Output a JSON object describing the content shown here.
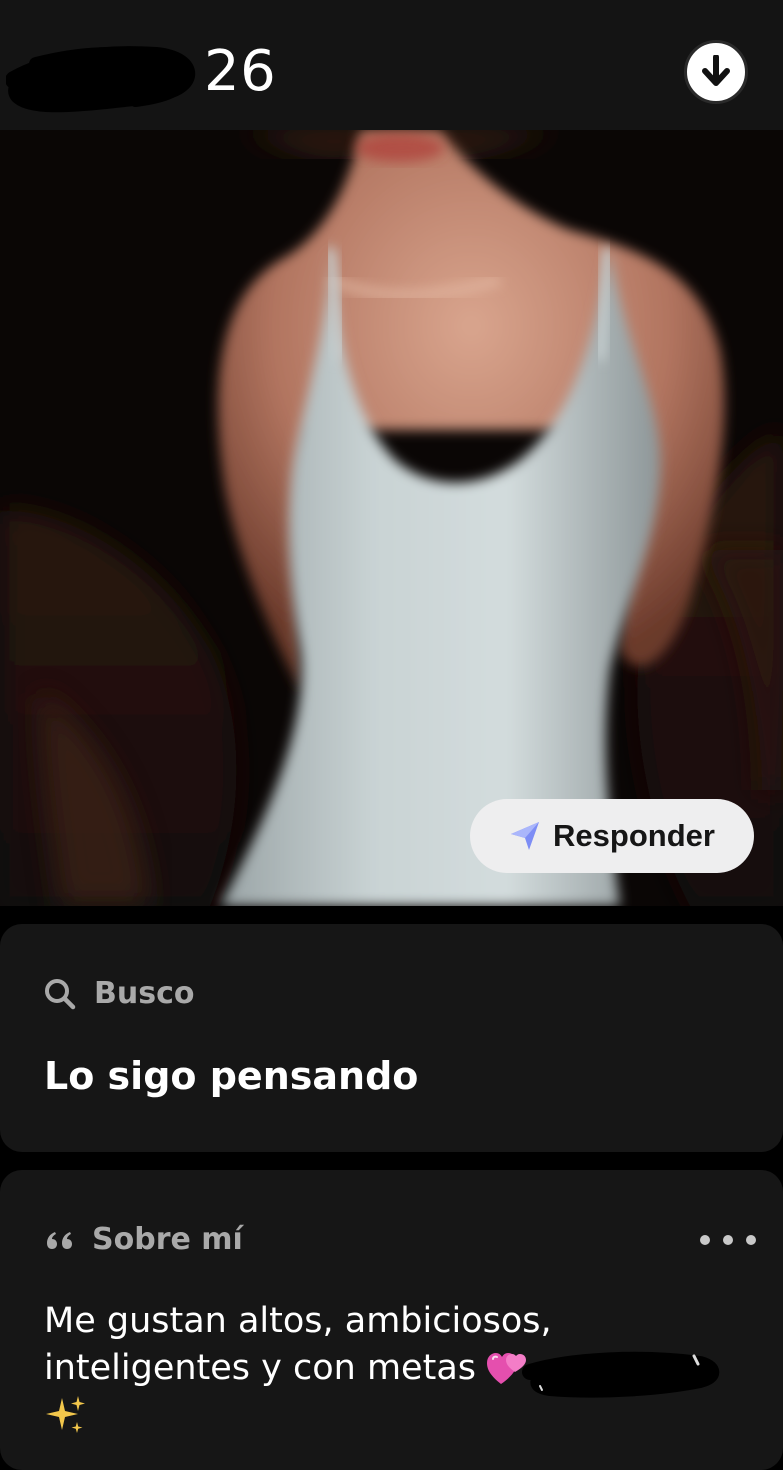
{
  "header": {
    "age": "26",
    "download_icon": "arrow-down-circle-icon"
  },
  "photo": {
    "reply_label": "Responder",
    "reply_icon": "send-arrow-icon"
  },
  "seek_card": {
    "label": "Busco",
    "label_icon": "search-icon",
    "value": "Lo sigo pensando"
  },
  "about_card": {
    "label": "Sobre mí",
    "label_icon": "quote-icon",
    "more_icon": "more-horizontal-icon",
    "line1": "Me gustan altos, ambiciosos,",
    "line2": "inteligentes y con metas",
    "emoji_heart": "💞",
    "emoji_sparkles": "✨"
  },
  "colors": {
    "background": "#000000",
    "card": "#161616",
    "label_gray": "#a9a9a9",
    "reply_bg": "#eeeeef",
    "send_icon": "#7d8df5"
  }
}
